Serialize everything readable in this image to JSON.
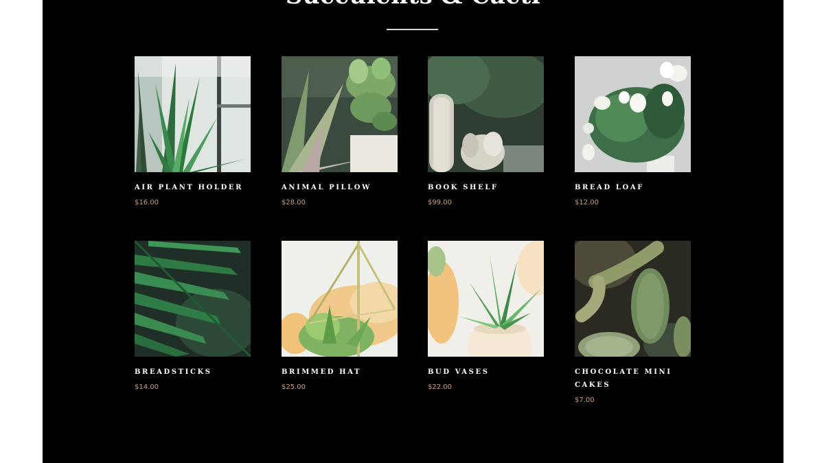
{
  "section": {
    "title": "Succulents & Cacti"
  },
  "colors": {
    "background": "#000000",
    "title": "#ffffff",
    "divider": "#d8d8d8",
    "product_name": "#ffffff",
    "price": "#c9a27e"
  },
  "products": [
    {
      "name": "AIR PLANT HOLDER",
      "price": "$16.00",
      "image": "tall-grass-plant-by-window-image"
    },
    {
      "name": "ANIMAL PILLOW",
      "price": "$28.00",
      "image": "succulent-pot-image"
    },
    {
      "name": "BOOK SHELF",
      "price": "$99.00",
      "image": "fuzzy-cactus-image"
    },
    {
      "name": "BREAD LOAF",
      "price": "$12.00",
      "image": "white-tulip-bouquet-image"
    },
    {
      "name": "BREADSTICKS",
      "price": "$14.00",
      "image": "palm-leaf-image"
    },
    {
      "name": "BRIMMED HAT",
      "price": "$25.00",
      "image": "hanging-terrarium-image"
    },
    {
      "name": "BUD VASES",
      "price": "$22.00",
      "image": "air-plant-vase-image"
    },
    {
      "name": "CHOCOLATE MINI CAKES",
      "price": "$7.00",
      "image": "spiny-cactus-image"
    }
  ]
}
